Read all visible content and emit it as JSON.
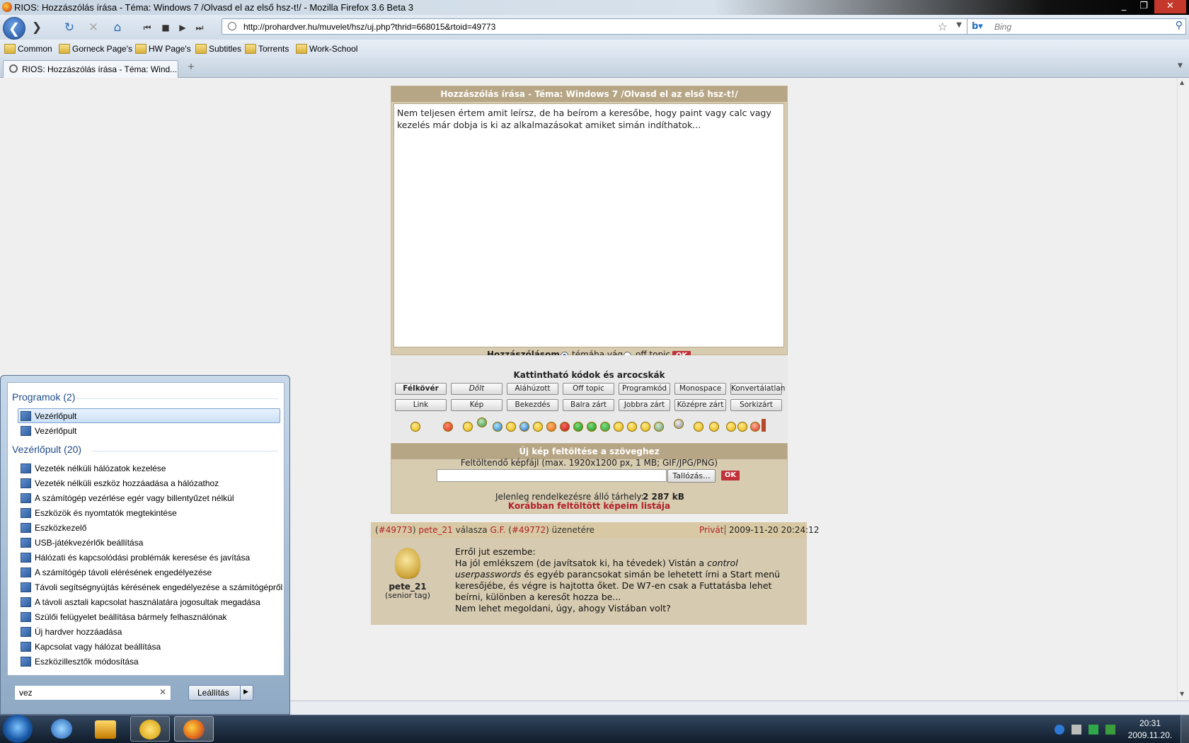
{
  "window": {
    "title": "RIOS: Hozzászólás írása - Téma: Windows 7 /Olvasd el az első hsz-t!/ - Mozilla Firefox 3.6 Beta 3",
    "controls": [
      "_",
      "❐",
      "✕"
    ]
  },
  "nav": {
    "url": "http://prohardver.hu/muvelet/hsz/uj.php?thrid=668015&rtoid=49773",
    "search_placeholder": "Bing"
  },
  "bookmarks": [
    "Common",
    "Gorneck Page's",
    "HW Page's",
    "Subtitles",
    "Torrents",
    "Work-School"
  ],
  "tabs": [
    {
      "label": "RIOS: Hozzászólás írása - Téma: Wind..."
    }
  ],
  "editor": {
    "header": "Hozzászólás írása - Téma: Windows 7 /Olvasd el az első hsz-t!/",
    "text": "Nem teljesen értem amit leírsz, de ha beírom a keresőbe, hogy paint vagy calc vagy kezelés már dobja is ki az alkalmazásokat amiket simán indíthatok...",
    "post_type_label": "Hozzászólásom",
    "option_topic": "témába vág",
    "option_offtopic": "off topic",
    "ok": "OK",
    "codes_title": "Kattintható kódok és arcocskák",
    "buttons_row1": [
      "Félkövér",
      "Dőlt",
      "Aláhúzott",
      "Off topic",
      "Programkód",
      "Monospace",
      "Konvertálatlan"
    ],
    "buttons_row2": [
      "Link",
      "Kép",
      "Bekezdés",
      "Balra zárt",
      "Jobbra zárt",
      "Középre zárt",
      "Sorkizárt"
    ]
  },
  "upload": {
    "header": "Új kép feltöltése a szöveghez",
    "file_label": "Feltöltendő képfájl (max. 1920x1200 px, 1 MB; GIF/JPG/PNG)",
    "browse": "Tallózás...",
    "ok": "OK",
    "space_label": "Jelenleg rendelkezésre álló tárhely:",
    "space_value": "2 287 kB",
    "list_link": "Korábban feltöltött képeim listája"
  },
  "post": {
    "id": "#49773",
    "author": "pete_21",
    "reply_word": "válasza",
    "reply_to": "G.F.",
    "reply_id": "#49772",
    "reply_suffix": "üzenetére",
    "private": "Privát",
    "date": "2009-11-20 20:24:12",
    "author_rank": "(senior tag)",
    "line1": "Erről jut eszembe:",
    "line2a": "Ha jól emlékszem (de javítsatok ki, ha tévedek) Vistán a",
    "line2b": "control userpasswords",
    "line2c": "és egyéb parancsokat simán be lehetett írni a Start menü keresőjébe, és végre is hajtotta őket. De W7-en csak a Futtatásba lehet beírni, különben a keresőt hozza be...",
    "line3": "Nem lehet megoldani, úgy, ahogy Vistában volt?"
  },
  "startmenu": {
    "programs_header": "Programok (2)",
    "programs": [
      "Vezérlőpult",
      "Vezérlőpult"
    ],
    "cp_header": "Vezérlőpult (20)",
    "cp_items": [
      "Vezeték nélküli hálózatok kezelése",
      "Vezeték nélküli eszköz hozzáadása a hálózathoz",
      "A számítógép vezérlése egér vagy billentyűzet nélkül",
      "Eszközök és nyomtatók megtekintése",
      "Eszközkezelő",
      "USB-játékvezérlők beállítása",
      "Hálózati és kapcsolódási problémák keresése és javítása",
      "A számítógép távoli elérésének engedélyezése",
      "Távoli segítségnyújtás kérésének engedélyezése a számítógépről",
      "A távoli asztali kapcsolat használatára jogosultak megadása",
      "Szülői felügyelet beállítása bármely felhasználónak",
      "Új hardver hozzáadása",
      "Kapcsolat vagy hálózat beállítása",
      "Eszközillesztők módosítása"
    ],
    "search_value": "vez",
    "shutdown": "Leállítás"
  },
  "taskbar": {
    "time": "20:31",
    "date": "2009.11.20."
  }
}
